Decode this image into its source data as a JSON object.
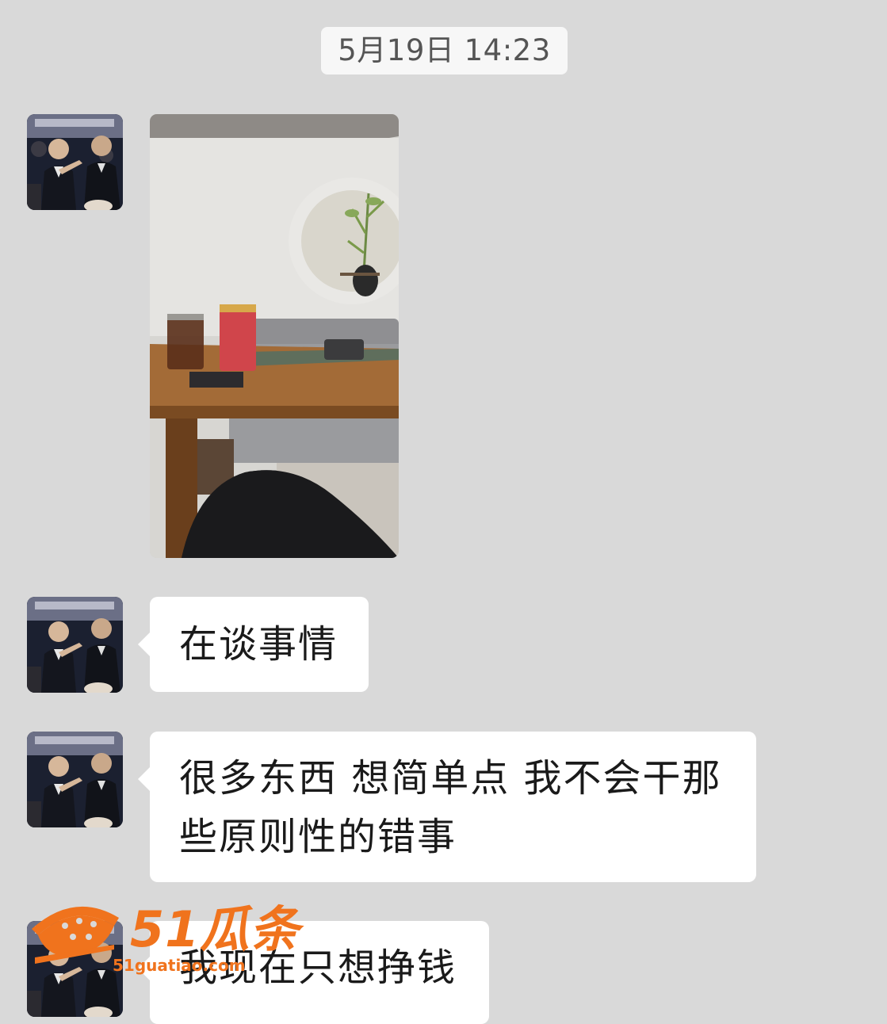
{
  "chat": {
    "timestamp": "5月19日 14:23",
    "messages": [
      {
        "type": "image",
        "description_icon": "photo-of-table-with-jars"
      },
      {
        "type": "text",
        "text": "在谈事情"
      },
      {
        "type": "text",
        "lines": [
          "很多东西 想简单点 我不会干那",
          "些原则性的错事"
        ]
      },
      {
        "type": "text",
        "text": "我现在只想挣钱"
      }
    ]
  },
  "watermark": {
    "brand": "51瓜条",
    "url": "51guatiao.com"
  },
  "colors": {
    "background": "#d9d9d9",
    "bubble": "#ffffff",
    "watermark": "#f0731d"
  }
}
